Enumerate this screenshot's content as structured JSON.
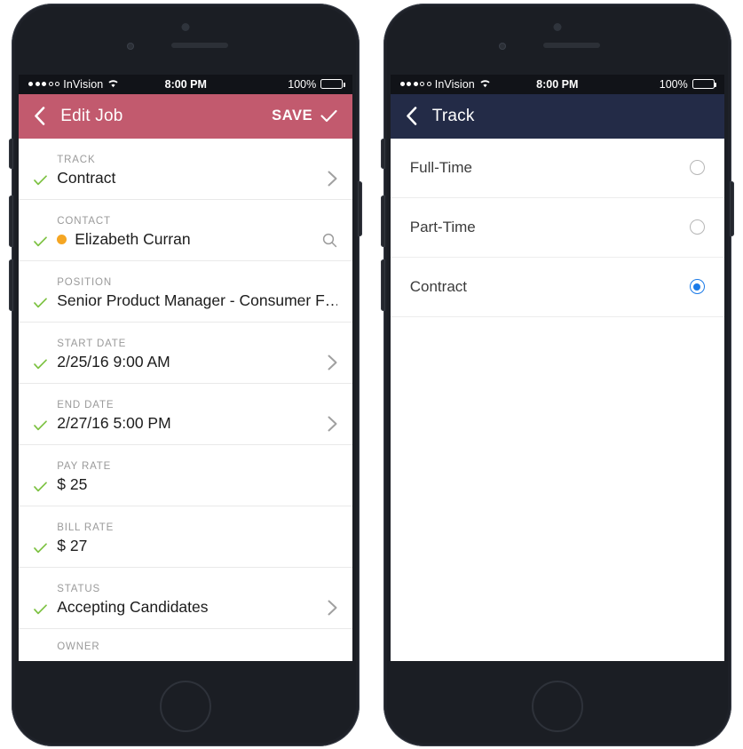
{
  "left_phone": {
    "status_bar": {
      "signal_filled": 3,
      "signal_hollow": 2,
      "carrier": "InVision",
      "wifi_icon": "wifi-icon",
      "time": "8:00 PM",
      "battery_percent": "100%",
      "battery_icon": "battery-full-icon"
    },
    "nav": {
      "back_icon": "chevron-left-icon",
      "title": "Edit Job",
      "save_label": "SAVE",
      "save_icon": "check-icon",
      "bar_color": "#c25a6e"
    },
    "rows": [
      {
        "label": "TRACK",
        "value": "Contract",
        "check_icon": "check-icon",
        "accessory": "chevron-right-icon"
      },
      {
        "label": "CONTACT",
        "value": "Elizabeth Curran",
        "check_icon": "check-icon",
        "dot_color": "#f5a623",
        "accessory": "search-icon"
      },
      {
        "label": "POSITION",
        "value": "Senior Product Manager - Consumer F…",
        "check_icon": "check-icon",
        "accessory": "none"
      },
      {
        "label": "START DATE",
        "value": "2/25/16 9:00 AM",
        "check_icon": "check-icon",
        "accessory": "chevron-right-icon"
      },
      {
        "label": "END DATE",
        "value": "2/27/16 5:00 PM",
        "check_icon": "check-icon",
        "accessory": "chevron-right-icon"
      },
      {
        "label": "PAY RATE",
        "value": "$ 25",
        "check_icon": "check-icon",
        "accessory": "none"
      },
      {
        "label": "BILL RATE",
        "value": "$ 27",
        "check_icon": "check-icon",
        "accessory": "none"
      },
      {
        "label": "STATUS",
        "value": "Accepting Candidates",
        "check_icon": "check-icon",
        "accessory": "chevron-right-icon"
      }
    ],
    "partial_row": {
      "label": "OWNER"
    },
    "check_color": "#7dc242"
  },
  "right_phone": {
    "status_bar": {
      "signal_filled": 3,
      "signal_hollow": 2,
      "carrier": "InVision",
      "wifi_icon": "wifi-icon",
      "time": "8:00 PM",
      "battery_percent": "100%",
      "battery_icon": "battery-full-icon"
    },
    "nav": {
      "back_icon": "chevron-left-icon",
      "title": "Track",
      "bar_color": "#232b47"
    },
    "options": [
      {
        "label": "Full-Time",
        "selected": false
      },
      {
        "label": "Part-Time",
        "selected": false
      },
      {
        "label": "Contract",
        "selected": true
      }
    ],
    "selected_color": "#1a7ae8"
  }
}
